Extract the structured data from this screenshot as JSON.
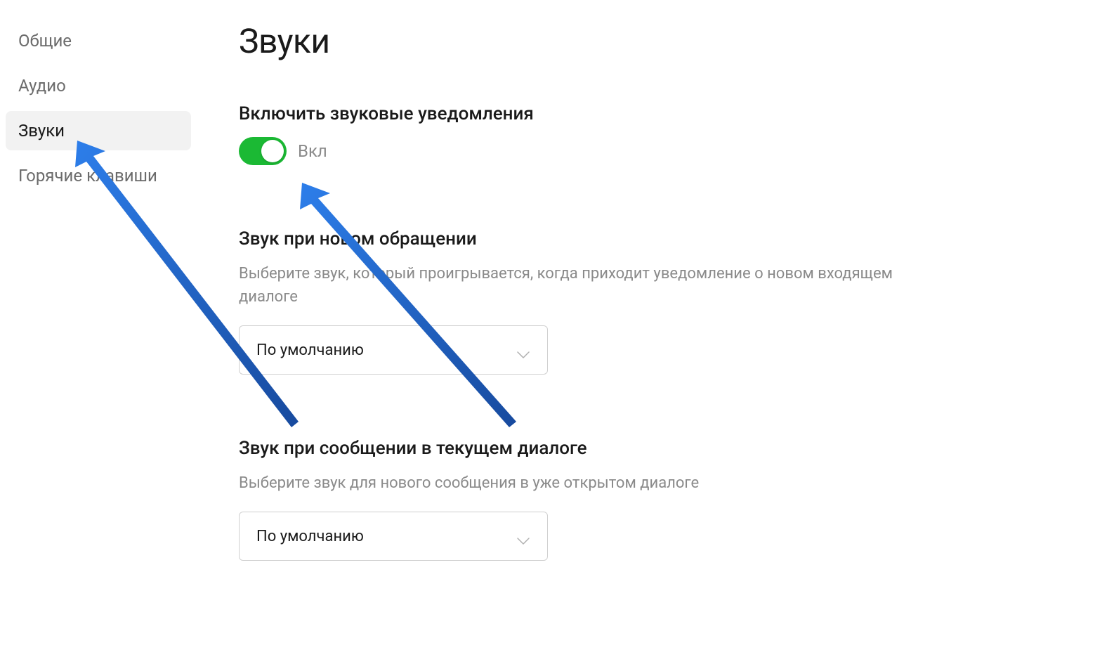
{
  "sidebar": {
    "items": [
      {
        "label": "Общие",
        "active": false
      },
      {
        "label": "Аудио",
        "active": false
      },
      {
        "label": "Звуки",
        "active": true
      },
      {
        "label": "Горячие клавиши",
        "active": false
      }
    ]
  },
  "page": {
    "title": "Звуки"
  },
  "sections": {
    "enable": {
      "title": "Включить звуковые уведомления",
      "toggle_state_label": "Вкл"
    },
    "new_request": {
      "title": "Звук при новом обращении",
      "description": "Выберите звук, который проигрывается, когда приходит уведомление о новом входящем диалоге",
      "selected": "По умолчанию"
    },
    "current_dialog": {
      "title": "Звук при сообщении в текущем диалоге",
      "description": "Выберите звук для нового сообщения в уже открытом диалоге",
      "selected": "По умолчанию"
    }
  },
  "colors": {
    "toggle_on": "#1bb934",
    "arrow": "#1c5fc4"
  }
}
